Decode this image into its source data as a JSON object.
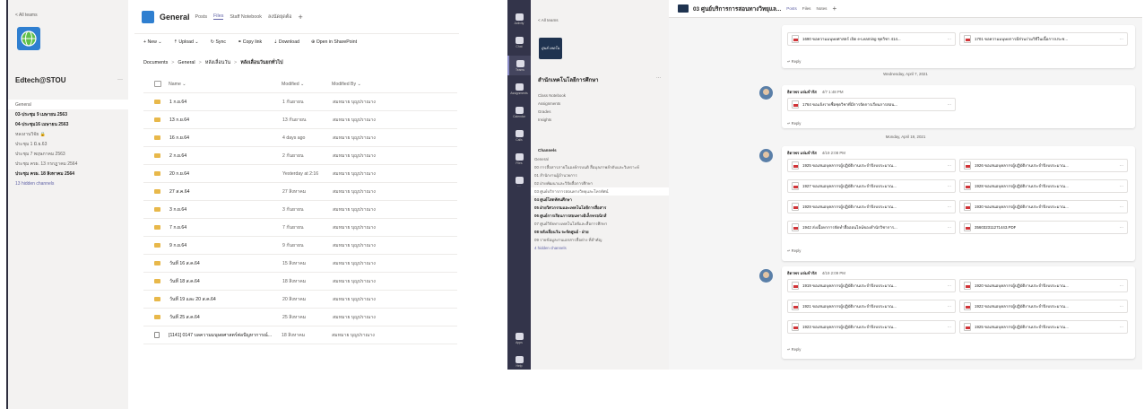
{
  "left_window": {
    "back_label": "< All teams",
    "team_name": "Edtech@STOU",
    "team_more": "···",
    "channels": [
      {
        "label": "General",
        "style": "active"
      },
      {
        "label": "03-ประชุม 9 เมษายน 2563",
        "style": "bold"
      },
      {
        "label": "04-ประชุม16 เมษายน 2563",
        "style": "bold"
      },
      {
        "label": "หลงงานวิจัย 🔒",
        "style": "normal"
      },
      {
        "label": "ประชุม 1 มิ.ย.63",
        "style": "normal"
      },
      {
        "label": "ประชุม 7 พฤษภาคม 2563",
        "style": "normal"
      },
      {
        "label": "ประชุม ครผ. 13 กรกฎาคม 2564",
        "style": "normal"
      },
      {
        "label": "ประชุม ครผ. 18 สิงหาคม 2564",
        "style": "bold"
      },
      {
        "label": "13 hidden channels",
        "style": "link"
      }
    ],
    "header": {
      "channel": "General",
      "tabs": [
        "Posts",
        "Files",
        "Staff Notebook",
        "ลงนัดยุดต้อ"
      ],
      "add": "+"
    },
    "toolbar": [
      {
        "icon": "plus-icon",
        "label": "+ New ⌄"
      },
      {
        "icon": "upload-icon",
        "label": "⇡ Upload ⌄"
      },
      {
        "icon": "sync-icon",
        "label": "↻ Sync"
      },
      {
        "icon": "link-icon",
        "label": "⚭ Copy link"
      },
      {
        "icon": "download-icon",
        "label": "⇣ Download"
      },
      {
        "icon": "sharepoint-icon",
        "label": "⊕ Open in SharePoint"
      }
    ],
    "breadcrumb": [
      "Documents",
      "General",
      "หลังเลื่อนวัน",
      "หลังเลื่อนวันยกทั่วไป"
    ],
    "columns": {
      "name": "Name ⌄",
      "modified": "Modified ⌄",
      "modified_by": "Modified By ⌄"
    },
    "files": [
      {
        "name": "1 ก.ย.64",
        "modified": "1 กันยายน",
        "by": "สมหมาย บุญปราณาง",
        "type": "folder"
      },
      {
        "name": "13 ก.ย.64",
        "modified": "13 กันยายน",
        "by": "สมหมาย บุญปราณาง",
        "type": "folder"
      },
      {
        "name": "16 ก.ย.64",
        "modified": "4 days ago",
        "by": "สมหมาย บุญปราณาง",
        "type": "folder"
      },
      {
        "name": "2 ก.ย.64",
        "modified": "2 กันยายน",
        "by": "สมหมาย บุญปราณาง",
        "type": "folder"
      },
      {
        "name": "20 ก.ย.64",
        "modified": "Yesterday at 2:16",
        "by": "สมหมาย บุญปราณาง",
        "type": "folder"
      },
      {
        "name": "27 ส.ค.64",
        "modified": "27 สิงหาคม",
        "by": "สมหมาย บุญปราณาง",
        "type": "folder"
      },
      {
        "name": "3 ก.ย.64",
        "modified": "3 กันยายน",
        "by": "สมหมาย บุญปราณาง",
        "type": "folder"
      },
      {
        "name": "7 ก.ย.64",
        "modified": "7 กันยายน",
        "by": "สมหมาย บุญปราณาง",
        "type": "folder"
      },
      {
        "name": "9 ก.ย.64",
        "modified": "9 กันยายน",
        "by": "สมหมาย บุญปราณาง",
        "type": "folder"
      },
      {
        "name": "วันที่ 16 ส.ค.64",
        "modified": "15 สิงหาคม",
        "by": "สมหมาย บุญปราณาง",
        "type": "folder"
      },
      {
        "name": "วันที่ 18 ส.ค.64",
        "modified": "18 สิงหาคม",
        "by": "สมหมาย บุญปราณาง",
        "type": "folder"
      },
      {
        "name": "วันที่ 19 และ 20 ส.ค.64",
        "modified": "20 สิงหาคม",
        "by": "สมหมาย บุญปราณาง",
        "type": "folder"
      },
      {
        "name": "วันที่ 25 ส.ค.64",
        "modified": "25 สิงหาคม",
        "by": "สมหมาย บุญปราณาง",
        "type": "folder"
      },
      {
        "name": "[1141] 0147 บลความมนุษยศาสตร์ต่อปัญหาการณ์...",
        "modified": "18 สิงหาคม",
        "by": "สมหมาย บุญปราณาง",
        "type": "file"
      }
    ]
  },
  "right_window": {
    "rail": [
      "Activity",
      "Chat",
      "Teams",
      "Assignments",
      "Calendar",
      "Calls",
      "Files",
      "···",
      "Apps",
      "Help"
    ],
    "back_label": "< All teams",
    "logo_text": "ศูนย์ เทคโน",
    "team_name": "สำนักเทคโนโลยีการศึกษา",
    "team_more": "···",
    "team_links": [
      "Class Notebook",
      "Assignments",
      "Grades",
      "Insights"
    ],
    "channels_title": "Channels",
    "channels": [
      {
        "label": "General",
        "style": "normal"
      },
      {
        "label": "00 การสื่อสารภายในองค์กรบนดิ สื่อมุลภาพลำดับและวิเคราะห์",
        "style": "normal"
      },
      {
        "label": "01 สำนักงานผู้อำนวยการ",
        "style": "normal"
      },
      {
        "label": "02 ฝ่ายพัฒนาและวิจัยสื่อการศึกษา",
        "style": "normal"
      },
      {
        "label": "03 ศูนย์บริการการสอนทางวิทยุและโทรทัศน์",
        "style": "active"
      },
      {
        "label": "04 ศูนย์โสตทัศนศึกษา",
        "style": "bold"
      },
      {
        "label": "05 ฝ่ายวิศวกรรมและเทคโนโลยีการสื่อสาร",
        "style": "bold"
      },
      {
        "label": "06 ศูนย์การเรียนการสอนทางอิเล็กทรอนิกส์",
        "style": "bold"
      },
      {
        "label": "07 ศูนย์วิจัยทางเทคโนโลยีและสื่อการศึกษา",
        "style": "normal"
      },
      {
        "label": "08 หลังเลื่อนวัน จะจัดศูนย์ - ฝ่าย",
        "style": "bold"
      },
      {
        "label": "09 รายข้อมูลงานเอกสารสื่อต่าง ที่สำคัญ",
        "style": "normal"
      },
      {
        "label": "4 hidden channels",
        "style": "link"
      }
    ],
    "header": {
      "channel": "03 ศูนย์บริการการสอนทางวิทยุแล...",
      "tabs": [
        "Posts",
        "Files",
        "Notes"
      ],
      "add": "+"
    },
    "top_card": {
      "atts": [
        "1690 ขอความมนุษยศาสตร์ เปิด e-Learning ชุดวิชา 414...",
        "1701 ขอความมนุษยการมีส่วนร่วมวิธีในเนื้อการประช..."
      ],
      "reply": "↵ Reply"
    },
    "date1": "Wednesday, April 7, 2021",
    "msg1": {
      "sender": "ธิดาพร แจ่มจำรัส",
      "time": "4/7 1:48 PM",
      "atts": [
        "1764 ขอแจ้งรายชื่อชุดวิชาที่มีการจัดการเรียนการสอน..."
      ],
      "reply": "↵ Reply"
    },
    "date2": "Monday, April 19, 2021",
    "msg2": {
      "sender": "ธิดาพร แจ่มจำรัส",
      "time": "4/19 2:08 PM",
      "atts": [
        "1925 ขอเสนอบุคลากรผู้ปฏิบัติงานประจำปีงบประมาณ...",
        "1926 ขอเสนอบุคลากรผู้ปฏิบัติงานประจำปีงบประมาณ...",
        "1927 ขอเสนอบุคลากรผู้ปฏิบัติงานประจำปีงบประมาณ...",
        "1928 ขอเสนอบุคลากรผู้ปฏิบัติงานประจำปีงบประมาณ...",
        "1929 ขอเสนอบุคลากรผู้ปฏิบัติงานประจำปีงบประมาณ...",
        "1930 ขอเสนอบุคลากรผู้ปฏิบัติงานประจำปีงบประมาณ...",
        "1942 ส่งเนื้อหาการจัดทำสื่อออนไลน์ของสำนักวิชาการ...",
        "356032311271443.PDF"
      ],
      "reply": "↵ Reply"
    },
    "msg3": {
      "sender": "ธิดาพร แจ่มจำรัส",
      "time": "4/19 2:09 PM",
      "atts": [
        "1919 ขอเสนอบุคลากรผู้ปฏิบัติงานประจำปีงบประมาณ...",
        "1920 ขอเสนอบุคลากรผู้ปฏิบัติงานประจำปีงบประมาณ...",
        "1921 ขอเสนอบุคลากรผู้ปฏิบัติงานประจำปีงบประมาณ...",
        "1922 ขอเสนอบุคลากรผู้ปฏิบัติงานประจำปีงบประมาณ...",
        "1923 ขอเสนอบุคลากรผู้ปฏิบัติงานประจำปีงบประมาณ...",
        "1925 ขอเสนอบุคลากรผู้ปฏิบัติงานประจำปีงบประมาณ..."
      ],
      "reply": "↵ Reply"
    },
    "more": "···"
  },
  "colors": {
    "teams_purple": "#6264a7",
    "rail": "#33344a",
    "folder": "#e8b84a",
    "pdf": "#d13438"
  }
}
